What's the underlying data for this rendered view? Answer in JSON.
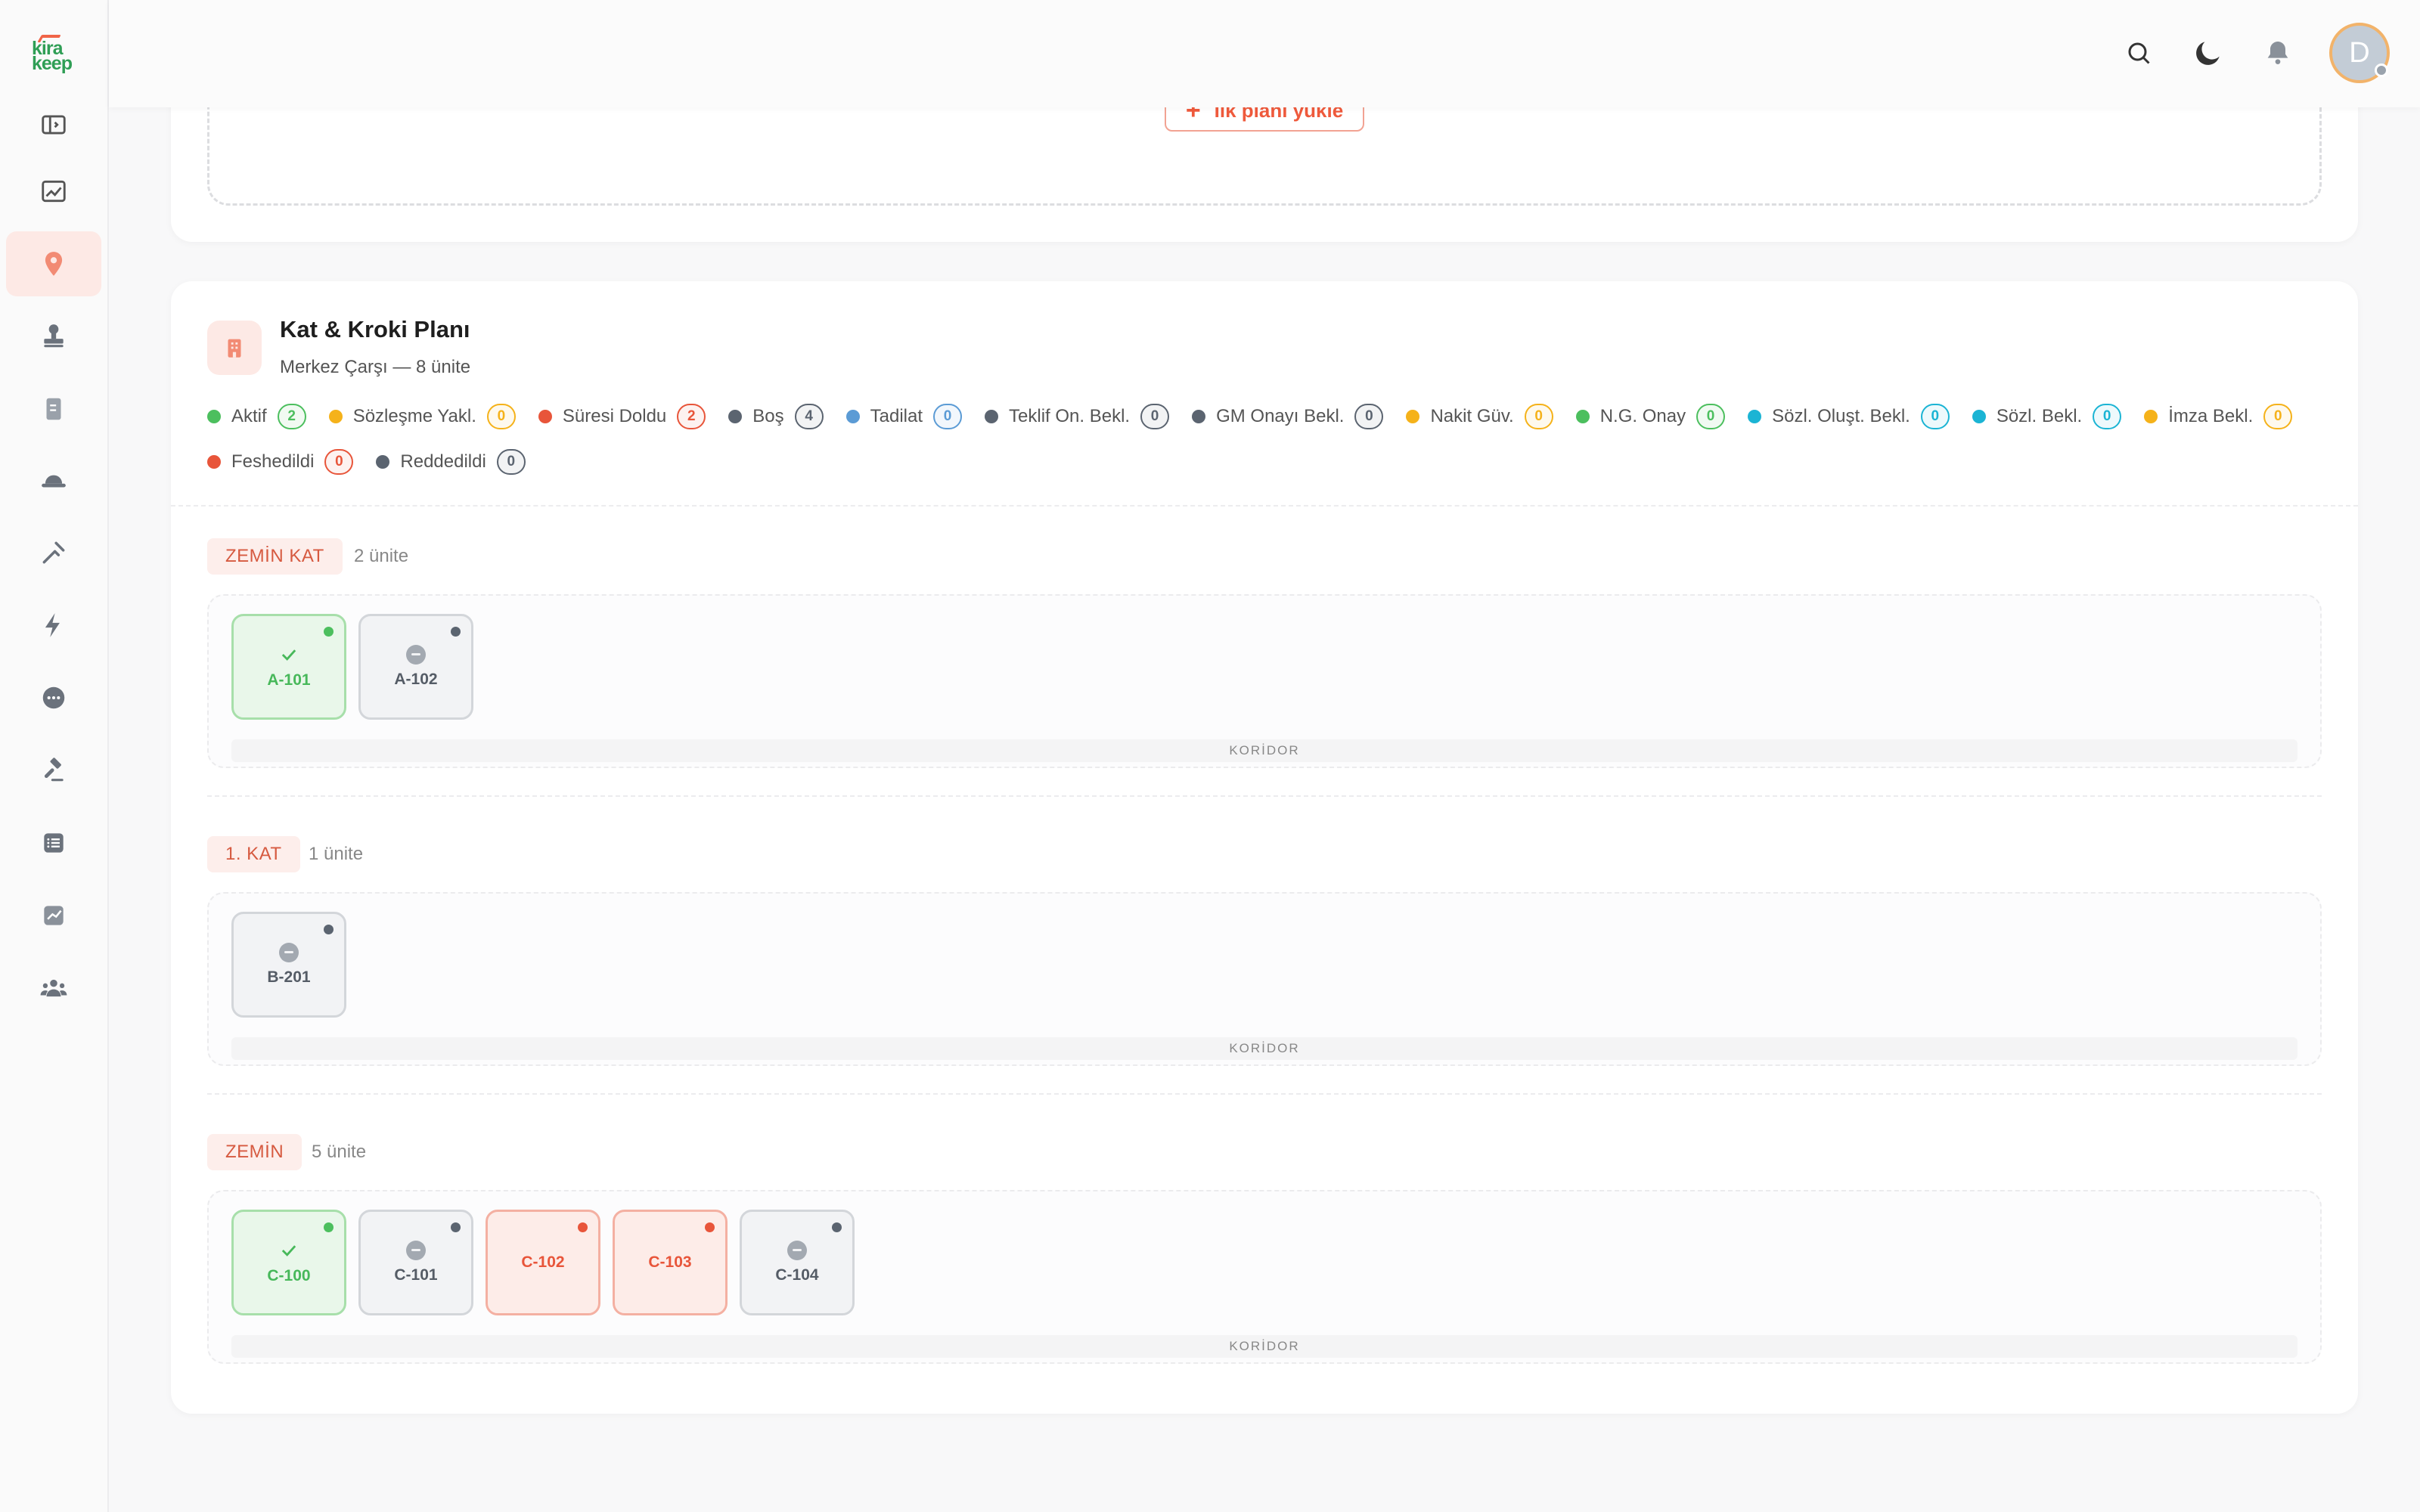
{
  "app": {
    "logo_line1": "kira",
    "logo_line2": "keep"
  },
  "sidebar": {
    "items": [
      {
        "icon": "panel-toggle-icon"
      },
      {
        "icon": "chart-icon"
      },
      {
        "icon": "location-pin-icon",
        "active": true
      },
      {
        "icon": "stamp-icon"
      },
      {
        "icon": "document-icon"
      },
      {
        "icon": "hat-icon"
      },
      {
        "icon": "tools-icon"
      },
      {
        "icon": "lightning-icon"
      },
      {
        "icon": "chat-icon"
      },
      {
        "icon": "gavel-icon"
      },
      {
        "icon": "list-icon"
      },
      {
        "icon": "trend-icon"
      },
      {
        "icon": "users-icon"
      }
    ]
  },
  "topbar": {
    "avatar_initial": "D"
  },
  "upload": {
    "label": "İlk planı yükle"
  },
  "plan": {
    "title": "Kat & Kroki Planı",
    "subtitle": "Merkez Çarşı — 8 ünite",
    "legend": [
      {
        "label": "Aktif",
        "count": "2",
        "color": "#4cbf5e"
      },
      {
        "label": "Sözleşme Yakl.",
        "count": "0",
        "color": "#f5b21a"
      },
      {
        "label": "Süresi Doldu",
        "count": "2",
        "color": "#e8553a"
      },
      {
        "label": "Boş",
        "count": "4",
        "color": "#5b6470"
      },
      {
        "label": "Tadilat",
        "count": "0",
        "color": "#5b9bd5"
      },
      {
        "label": "Teklif On. Bekl.",
        "count": "0",
        "color": "#5b6470"
      },
      {
        "label": "GM Onayı Bekl.",
        "count": "0",
        "color": "#5b6470"
      },
      {
        "label": "Nakit Güv.",
        "count": "0",
        "color": "#f5b21a"
      },
      {
        "label": "N.G. Onay",
        "count": "0",
        "color": "#4cbf5e"
      },
      {
        "label": "Sözl. Oluşt. Bekl.",
        "count": "0",
        "color": "#1bb4d4"
      },
      {
        "label": "Sözl. Bekl.",
        "count": "0",
        "color": "#1bb4d4"
      },
      {
        "label": "İmza Bekl.",
        "count": "0",
        "color": "#f5b21a"
      },
      {
        "label": "Feshedildi",
        "count": "0",
        "color": "#e8553a"
      },
      {
        "label": "Reddedildi",
        "count": "0",
        "color": "#5b6470"
      }
    ],
    "corridor_label": "KORİDOR",
    "floors": [
      {
        "name": "ZEMİN KAT",
        "count": "2 ünite",
        "units": [
          {
            "code": "A-101",
            "status": "aktif"
          },
          {
            "code": "A-102",
            "status": "bos"
          }
        ]
      },
      {
        "name": "1. KAT",
        "count": "1 ünite",
        "units": [
          {
            "code": "B-201",
            "status": "bos"
          }
        ]
      },
      {
        "name": "ZEMİN",
        "count": "5 ünite",
        "units": [
          {
            "code": "C-100",
            "status": "aktif"
          },
          {
            "code": "C-101",
            "status": "bos"
          },
          {
            "code": "C-102",
            "status": "sure"
          },
          {
            "code": "C-103",
            "status": "sure"
          },
          {
            "code": "C-104",
            "status": "bos"
          }
        ]
      }
    ]
  }
}
